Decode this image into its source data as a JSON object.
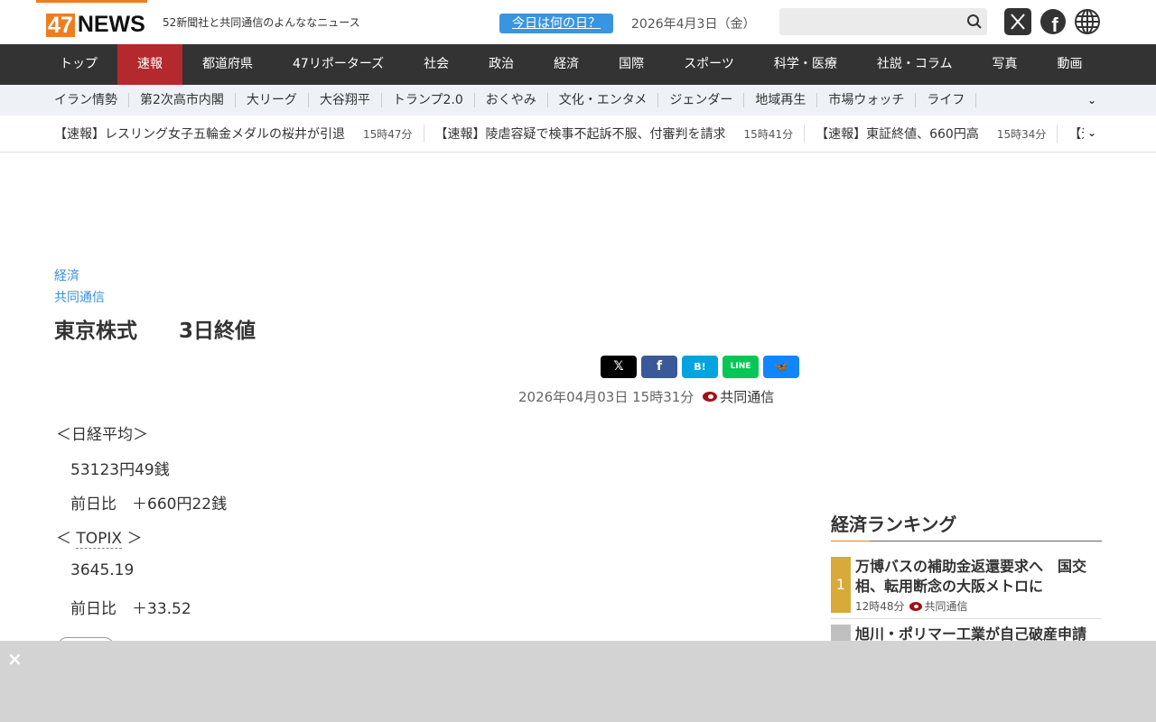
{
  "header": {
    "logo_num": "47",
    "logo_word": "NEWS",
    "tagline": "52新聞社と共同通信のよんななニュース",
    "today_button": "今日は何の日？",
    "date": "2026年4月3日（金）",
    "search_placeholder": ""
  },
  "nav": [
    "トップ",
    "速報",
    "都道府県",
    "47リポーターズ",
    "社会",
    "政治",
    "経済",
    "国際",
    "スポーツ",
    "科学・医療",
    "社説・コラム",
    "写真",
    "動画"
  ],
  "subnav": [
    "イラン情勢",
    "第2次高市内閣",
    "大リーグ",
    "大谷翔平",
    "トランプ2.0",
    "おくやみ",
    "文化・エンタメ",
    "ジェンダー",
    "地域再生",
    "市場ウォッチ",
    "ライフ"
  ],
  "ticker": [
    {
      "title": "【速報】レスリング女子五輪金メダルの桜井が引退",
      "time": "15時47分"
    },
    {
      "title": "【速報】陵虐容疑で検事不起訴不服、付審判を請求",
      "time": "15時41分"
    },
    {
      "title": "【速報】東証終値、660円高",
      "time": "15時34分"
    },
    {
      "title": "【速",
      "time": ""
    }
  ],
  "article": {
    "category": "経済",
    "source": "共同通信",
    "title": "東京株式　　3日終値",
    "datetime": "2026年04月03日 15時31分",
    "provider": "共同通信",
    "share": {
      "x": "𝕏",
      "facebook": "f",
      "hatena": "B!",
      "line": "LINE",
      "bluesky": "🦋"
    },
    "lines": [
      "＜日経平均＞",
      "53123円49銭",
      "前日比　＋660円22銭",
      "3645.19",
      "前日比　＋33.52"
    ],
    "topix_open": "＜ ",
    "topix": "TOPIX",
    "topix_close": " ＞"
  },
  "ranking": {
    "title": "経済ランキング",
    "items": [
      {
        "rank": "1",
        "title": "万博バスの補助金返還要求へ　国交相、転用断念の大阪メトロに",
        "time": "12時48分",
        "source": "共同通信"
      },
      {
        "rank": "",
        "title": "旭川・ポリマー工業が自己破産申請"
      }
    ]
  },
  "ad": {
    "close": "×"
  }
}
